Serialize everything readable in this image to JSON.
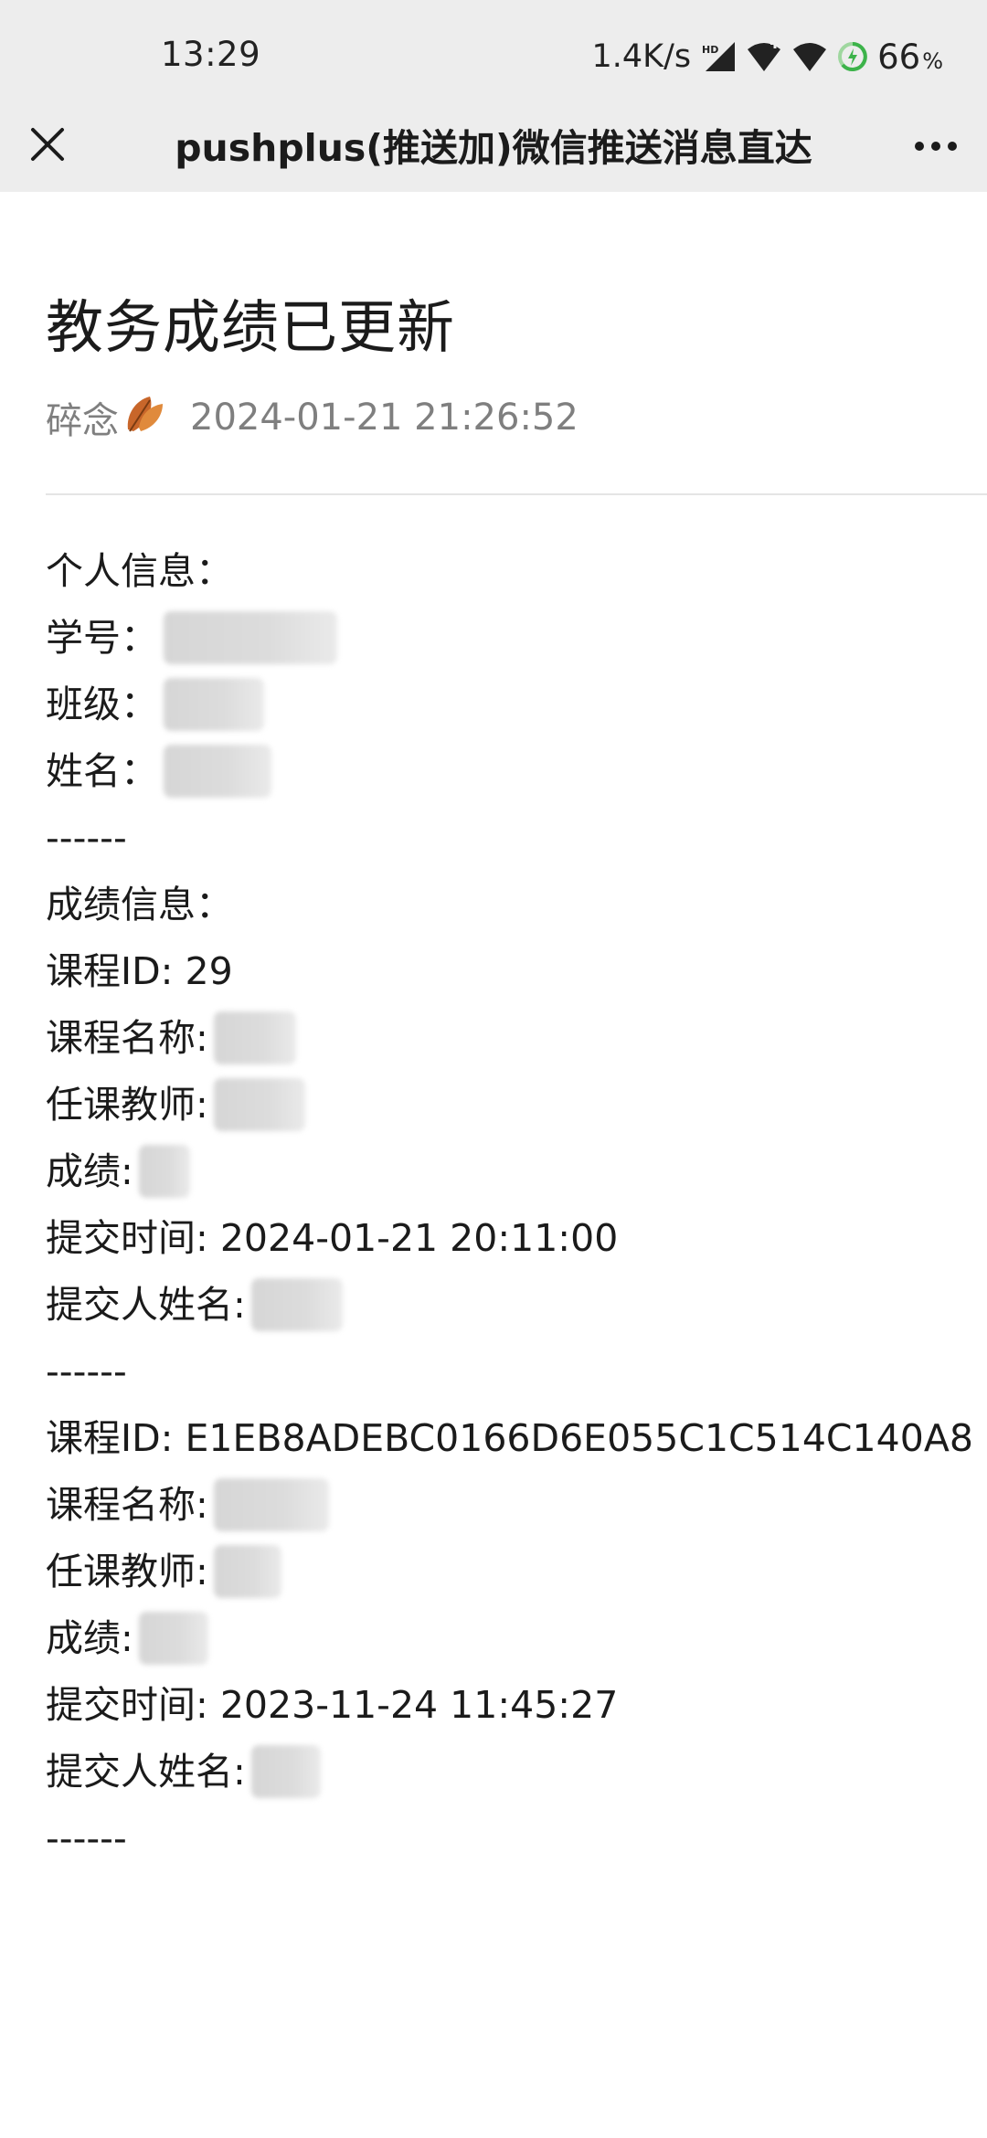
{
  "status_bar": {
    "time": "13:29",
    "net_speed": "1.4K/s",
    "battery": "66",
    "battery_unit": "%",
    "icons": [
      "hd-signal-icon",
      "wifi-plus-icon",
      "wifi-icon",
      "battery-charging-icon"
    ]
  },
  "title_bar": {
    "title": "pushplus(推送加)微信推送消息直达",
    "close_icon": "close-icon",
    "more_icon": "more-icon"
  },
  "article": {
    "title": "教务成绩已更新",
    "author": "碎念",
    "author_emoji": "leaf-icon",
    "time": "2024-01-21 21:26:52"
  },
  "content": {
    "personal_header": "个人信息：",
    "student_id_label": "学号：",
    "class_label": "班级：",
    "name_label": "姓名：",
    "separator_1": "------",
    "grades_header": "成绩信息：",
    "records": [
      {
        "course_id": "课程ID: 29",
        "course_name_label": "课程名称:",
        "teacher_label": "任课教师:",
        "score_label": "成绩:",
        "submit_time": "提交时间: 2024-01-21 20:11:00",
        "submitter_label": "提交人姓名:",
        "separator": "------"
      },
      {
        "course_id": "课程ID: E1EB8ADEBC0166D6E055C1C514C140A8",
        "course_name_label": "课程名称:",
        "teacher_label": "任课教师:",
        "score_label": "成绩:",
        "submit_time": "提交时间: 2023-11-24 11:45:27",
        "submitter_label": "提交人姓名:",
        "separator": "------"
      }
    ]
  },
  "colors": {
    "chrome_bg": "#ededed",
    "text": "#1b1b1b",
    "meta_text": "#7f7f7f",
    "divider": "#e5e5e5"
  }
}
